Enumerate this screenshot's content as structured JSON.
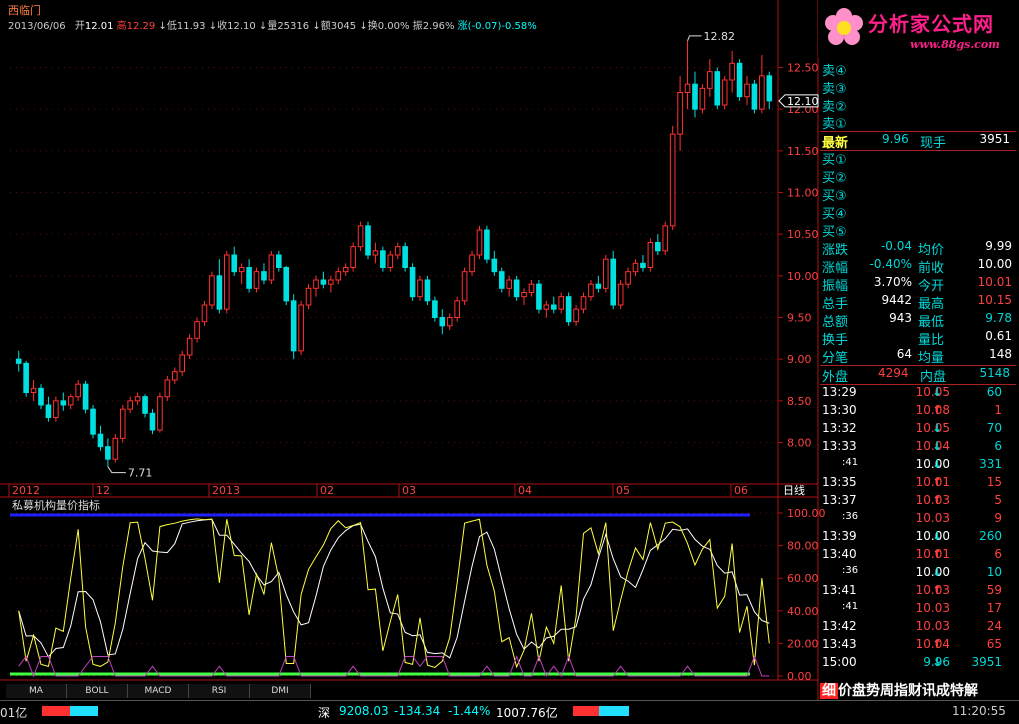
{
  "stock_name": "西临门",
  "header": {
    "date": "2013/06/06",
    "open_label": "开",
    "open": "12.01",
    "high_label": "高",
    "high": "12.29",
    "low_label": "低",
    "low": "11.93",
    "close_label": "收",
    "close": "12.10",
    "volume_label": "量",
    "volume": "25316",
    "amount_label": "额",
    "amount": "3045",
    "turnover_label": "换",
    "turnover": "0.00%",
    "amplitude_label": "振",
    "amplitude": "2.96%",
    "change_label": "涨",
    "change": "(-0.07)-0.58%"
  },
  "annotations": {
    "max": "12.82",
    "min": "7.71",
    "last": "12.10"
  },
  "x_labels": [
    "2012",
    "12",
    "2013",
    "02",
    "03",
    "04",
    "05",
    "06",
    "日线"
  ],
  "indicator_title": "私募机构量价指标",
  "indicator_ticks": [
    "100.00",
    "80.00",
    "60.00",
    "40.00",
    "20.00",
    "0.00"
  ],
  "tabs": [
    "MA",
    "BOLL",
    "MACD",
    "RSI",
    "DMI"
  ],
  "banner": {
    "title": "分析家公式网",
    "url": "www.88gs.com"
  },
  "quote": {
    "sells": [
      "卖④",
      "卖③",
      "卖②",
      "卖①"
    ],
    "latest_label": "最新",
    "latest": "9.96",
    "hand_label": "现手",
    "hand": "3951",
    "buys": [
      "买①",
      "买②",
      "买③",
      "买④",
      "买⑤"
    ],
    "stats": [
      {
        "l1": "涨跌",
        "v1": "-0.04",
        "l2": "均价",
        "v2": "9.99"
      },
      {
        "l1": "涨幅",
        "v1": "-0.40%",
        "l2": "前收",
        "v2": "10.00"
      },
      {
        "l1": "振幅",
        "v1": "3.70%",
        "l2": "今开",
        "v2": "10.01"
      },
      {
        "l1": "总手",
        "v1": "9442",
        "l2": "最高",
        "v2": "10.15"
      },
      {
        "l1": "总额",
        "v1": "943",
        "l2": "最低",
        "v2": "9.78"
      },
      {
        "l1": "换手",
        "v1": "",
        "l2": "量比",
        "v2": "0.61"
      },
      {
        "l1": "分笔",
        "v1": "64",
        "l2": "均量",
        "v2": "148"
      }
    ],
    "outer_label": "外盘",
    "outer": "4294",
    "inner_label": "内盘",
    "inner": "5148"
  },
  "ticks": [
    {
      "time": "13:29",
      "price": "10.05",
      "dir": "↓",
      "vol": "60"
    },
    {
      "time": "13:30",
      "price": "10.08",
      "dir": "↑",
      "vol": "1"
    },
    {
      "time": "13:32",
      "price": "10.05",
      "dir": "↓",
      "vol": "70"
    },
    {
      "time": "13:33",
      "price": "10.04",
      "dir": "↓",
      "vol": "6"
    },
    {
      "time": ":41",
      "price": "10.00",
      "dir": "↓",
      "vol": "331"
    },
    {
      "time": "13:35",
      "price": "10.01",
      "dir": "↑",
      "vol": "15"
    },
    {
      "time": "13:37",
      "price": "10.03",
      "dir": "↑",
      "vol": "5"
    },
    {
      "time": ":36",
      "price": "10.03",
      "dir": "",
      "vol": "9"
    },
    {
      "time": "13:39",
      "price": "10.00",
      "dir": "↓",
      "vol": "260"
    },
    {
      "time": "13:40",
      "price": "10.01",
      "dir": "↑",
      "vol": "6"
    },
    {
      "time": ":36",
      "price": "10.00",
      "dir": "↓",
      "vol": "10"
    },
    {
      "time": "13:41",
      "price": "10.03",
      "dir": "↑",
      "vol": "59"
    },
    {
      "time": ":41",
      "price": "10.03",
      "dir": "",
      "vol": "17"
    },
    {
      "time": "13:42",
      "price": "10.03",
      "dir": "",
      "vol": "24"
    },
    {
      "time": "13:43",
      "price": "10.04",
      "dir": "↑",
      "vol": "65"
    },
    {
      "time": "15:00",
      "price": "9.96",
      "dir": "↓",
      "vol": "3951"
    }
  ],
  "detail_tabs": "细价盘势周指财讯成特解",
  "bottom": {
    "left": "01亿",
    "market": "深",
    "index": "9208.03",
    "chg": "-134.34",
    "pct": "-1.44%",
    "amt": "1007.76亿",
    "time": "11:20:55"
  },
  "colors": {
    "up": "#ff3030",
    "down": "#00e0e0",
    "k_line": "#ffff40",
    "d_line": "#ffffff",
    "hist": "#c040c0",
    "top_line": "#2020ff",
    "bottom_line": "#40ff40"
  },
  "chart_data": {
    "type": "candlestick",
    "title": "西临门",
    "y_ticks": [
      8.0,
      8.5,
      9.0,
      9.5,
      10.0,
      10.5,
      11.0,
      11.5,
      12.0,
      12.5
    ],
    "ylim": [
      7.55,
      12.95
    ],
    "series": [
      {
        "name": "price",
        "ohlc": [
          [
            9.0,
            9.1,
            8.85,
            8.95
          ],
          [
            8.95,
            8.98,
            8.55,
            8.6
          ],
          [
            8.6,
            8.75,
            8.5,
            8.65
          ],
          [
            8.65,
            8.7,
            8.4,
            8.45
          ],
          [
            8.45,
            8.55,
            8.25,
            8.3
          ],
          [
            8.3,
            8.55,
            8.25,
            8.5
          ],
          [
            8.5,
            8.6,
            8.38,
            8.45
          ],
          [
            8.45,
            8.58,
            8.4,
            8.55
          ],
          [
            8.55,
            8.75,
            8.5,
            8.7
          ],
          [
            8.7,
            8.74,
            8.35,
            8.4
          ],
          [
            8.4,
            8.45,
            8.05,
            8.1
          ],
          [
            8.1,
            8.2,
            7.9,
            7.95
          ],
          [
            7.95,
            8.05,
            7.71,
            7.8
          ],
          [
            7.8,
            8.1,
            7.76,
            8.05
          ],
          [
            8.05,
            8.45,
            8.0,
            8.4
          ],
          [
            8.4,
            8.55,
            8.35,
            8.5
          ],
          [
            8.5,
            8.6,
            8.45,
            8.55
          ],
          [
            8.55,
            8.58,
            8.3,
            8.35
          ],
          [
            8.35,
            8.4,
            8.1,
            8.15
          ],
          [
            8.15,
            8.6,
            8.12,
            8.55
          ],
          [
            8.55,
            8.8,
            8.5,
            8.75
          ],
          [
            8.75,
            8.9,
            8.7,
            8.85
          ],
          [
            8.85,
            9.1,
            8.8,
            9.05
          ],
          [
            9.05,
            9.3,
            9.0,
            9.25
          ],
          [
            9.25,
            9.5,
            9.2,
            9.45
          ],
          [
            9.45,
            9.7,
            9.4,
            9.65
          ],
          [
            9.65,
            10.05,
            9.6,
            10.0
          ],
          [
            10.0,
            10.2,
            9.55,
            9.6
          ],
          [
            9.6,
            10.3,
            9.55,
            10.25
          ],
          [
            10.25,
            10.35,
            10.0,
            10.05
          ],
          [
            10.05,
            10.15,
            9.9,
            10.1
          ],
          [
            10.1,
            10.2,
            9.8,
            9.85
          ],
          [
            9.85,
            10.1,
            9.8,
            10.05
          ],
          [
            10.05,
            10.15,
            9.9,
            9.95
          ],
          [
            9.95,
            10.3,
            9.9,
            10.25
          ],
          [
            10.25,
            10.3,
            10.05,
            10.1
          ],
          [
            10.1,
            10.12,
            9.65,
            9.7
          ],
          [
            9.7,
            9.78,
            9.0,
            9.1
          ],
          [
            9.1,
            9.7,
            9.05,
            9.65
          ],
          [
            9.65,
            9.9,
            9.6,
            9.85
          ],
          [
            9.85,
            10.0,
            9.75,
            9.95
          ],
          [
            9.95,
            10.05,
            9.85,
            9.9
          ],
          [
            9.9,
            10.0,
            9.8,
            9.95
          ],
          [
            9.95,
            10.1,
            9.9,
            10.05
          ],
          [
            10.05,
            10.15,
            10.0,
            10.1
          ],
          [
            10.1,
            10.4,
            10.05,
            10.35
          ],
          [
            10.35,
            10.65,
            10.3,
            10.6
          ],
          [
            10.6,
            10.65,
            10.2,
            10.25
          ],
          [
            10.25,
            10.4,
            10.15,
            10.3
          ],
          [
            10.3,
            10.35,
            10.05,
            10.1
          ],
          [
            10.1,
            10.3,
            10.05,
            10.25
          ],
          [
            10.25,
            10.4,
            10.2,
            10.35
          ],
          [
            10.35,
            10.4,
            10.05,
            10.1
          ],
          [
            10.1,
            10.15,
            9.7,
            9.75
          ],
          [
            9.75,
            10.0,
            9.7,
            9.95
          ],
          [
            9.95,
            10.0,
            9.65,
            9.7
          ],
          [
            9.7,
            9.75,
            9.45,
            9.5
          ],
          [
            9.5,
            9.6,
            9.3,
            9.4
          ],
          [
            9.4,
            9.55,
            9.35,
            9.5
          ],
          [
            9.5,
            9.75,
            9.45,
            9.7
          ],
          [
            9.7,
            10.1,
            9.65,
            10.05
          ],
          [
            10.05,
            10.3,
            10.0,
            10.25
          ],
          [
            10.25,
            10.6,
            10.2,
            10.55
          ],
          [
            10.55,
            10.6,
            10.15,
            10.2
          ],
          [
            10.2,
            10.3,
            10.0,
            10.05
          ],
          [
            10.05,
            10.1,
            9.8,
            9.85
          ],
          [
            9.85,
            10.0,
            9.75,
            9.95
          ],
          [
            9.95,
            10.0,
            9.7,
            9.75
          ],
          [
            9.75,
            9.85,
            9.65,
            9.8
          ],
          [
            9.8,
            9.95,
            9.75,
            9.9
          ],
          [
            9.9,
            9.95,
            9.55,
            9.6
          ],
          [
            9.6,
            9.7,
            9.5,
            9.65
          ],
          [
            9.65,
            9.75,
            9.55,
            9.6
          ],
          [
            9.6,
            9.8,
            9.55,
            9.75
          ],
          [
            9.75,
            9.8,
            9.4,
            9.45
          ],
          [
            9.45,
            9.65,
            9.4,
            9.6
          ],
          [
            9.6,
            9.8,
            9.55,
            9.75
          ],
          [
            9.75,
            9.95,
            9.7,
            9.9
          ],
          [
            9.9,
            10.0,
            9.8,
            9.85
          ],
          [
            9.85,
            10.25,
            9.8,
            10.2
          ],
          [
            10.2,
            10.3,
            9.6,
            9.65
          ],
          [
            9.65,
            9.95,
            9.6,
            9.9
          ],
          [
            9.9,
            10.1,
            9.85,
            10.05
          ],
          [
            10.05,
            10.2,
            10.0,
            10.15
          ],
          [
            10.15,
            10.25,
            10.05,
            10.1
          ],
          [
            10.1,
            10.45,
            10.05,
            10.4
          ],
          [
            10.4,
            10.5,
            10.25,
            10.3
          ],
          [
            10.3,
            10.65,
            10.25,
            10.6
          ],
          [
            10.6,
            11.8,
            10.55,
            11.7
          ],
          [
            11.7,
            12.4,
            11.5,
            12.2
          ],
          [
            12.2,
            12.82,
            12.0,
            12.3
          ],
          [
            12.3,
            12.45,
            11.9,
            12.0
          ],
          [
            12.0,
            12.3,
            11.95,
            12.25
          ],
          [
            12.25,
            12.6,
            12.15,
            12.45
          ],
          [
            12.45,
            12.5,
            12.0,
            12.05
          ],
          [
            12.05,
            12.4,
            12.0,
            12.35
          ],
          [
            12.35,
            12.7,
            12.2,
            12.55
          ],
          [
            12.55,
            12.6,
            12.1,
            12.15
          ],
          [
            12.15,
            12.4,
            12.05,
            12.3
          ],
          [
            12.3,
            12.35,
            11.95,
            12.0
          ],
          [
            12.0,
            12.65,
            11.95,
            12.4
          ],
          [
            12.4,
            12.45,
            12.0,
            12.1
          ]
        ]
      }
    ]
  }
}
